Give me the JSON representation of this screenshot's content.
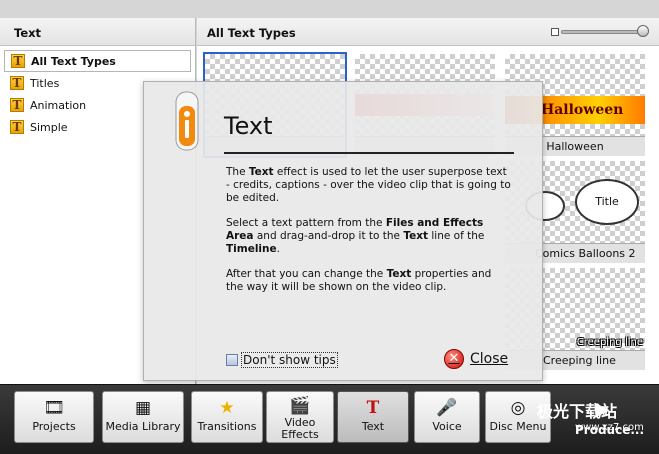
{
  "left_panel": {
    "header": "Text",
    "items": [
      {
        "label": "All Text Types",
        "selected": true
      },
      {
        "label": "Titles"
      },
      {
        "label": "Animation"
      },
      {
        "label": "Simple"
      }
    ]
  },
  "right_panel": {
    "header": "All Text Types",
    "thumbnails": [
      {
        "label": ""
      },
      {
        "label": ""
      },
      {
        "label": "Halloween",
        "art_text": "Halloween"
      },
      {
        "label": "Comics Balloons 2",
        "art_text": "Title"
      },
      {
        "label": "Creeping line",
        "art_text": "Creeping line"
      }
    ]
  },
  "dialog": {
    "title": "Text",
    "p1_a": "The ",
    "p1_b": "Text",
    "p1_c": " effect is used to let the user superpose text - credits, captions - over the video clip that is going to be edited.",
    "p2_a": "Select a text pattern from the ",
    "p2_b": "Files and Effects Area",
    "p2_c": " and drag-and-drop it to the ",
    "p2_d": "Text",
    "p2_e": " line of the ",
    "p2_f": "Timeline",
    "p2_g": ".",
    "p3_a": "After that you can change the ",
    "p3_b": "Text",
    "p3_c": " properties and the way it will be shown on the video clip.",
    "checkbox_label": "Don't show tips",
    "checkbox_checked": false,
    "close_label": "Close"
  },
  "toolbar": {
    "buttons": [
      {
        "label": "Projects",
        "icon": "film-reel-icon"
      },
      {
        "label": "Media Library",
        "icon": "media-library-icon"
      },
      {
        "label": "Transitions",
        "icon": "star-icon"
      },
      {
        "label": "Video Effects",
        "icon": "video-effects-icon"
      },
      {
        "label": "Text",
        "icon": "text-icon",
        "active": true
      },
      {
        "label": "Voice",
        "icon": "microphone-icon"
      },
      {
        "label": "Disc Menu",
        "icon": "disc-icon"
      }
    ],
    "produce_label": "Produce..."
  },
  "watermark": {
    "cn": "极光下载站",
    "url": "www.xz7.com"
  }
}
